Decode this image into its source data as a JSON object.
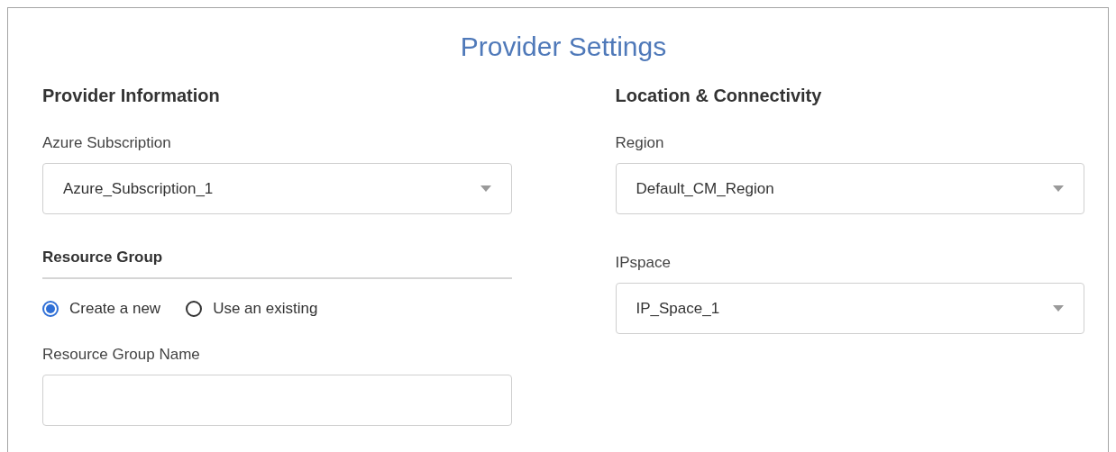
{
  "title": "Provider Settings",
  "left": {
    "heading": "Provider Information",
    "subscription": {
      "label": "Azure Subscription",
      "value": "Azure_Subscription_1"
    },
    "resource_group": {
      "heading": "Resource Group",
      "options": [
        {
          "label": "Create a new",
          "selected": true
        },
        {
          "label": "Use an existing",
          "selected": false
        }
      ],
      "name_field": {
        "label": "Resource Group Name"
      }
    }
  },
  "right": {
    "heading": "Location & Connectivity",
    "fields": [
      {
        "label": "Region",
        "value": "Default_CM_Region"
      },
      {
        "label": "IPspace",
        "value": "IP_Space_1"
      }
    ]
  }
}
